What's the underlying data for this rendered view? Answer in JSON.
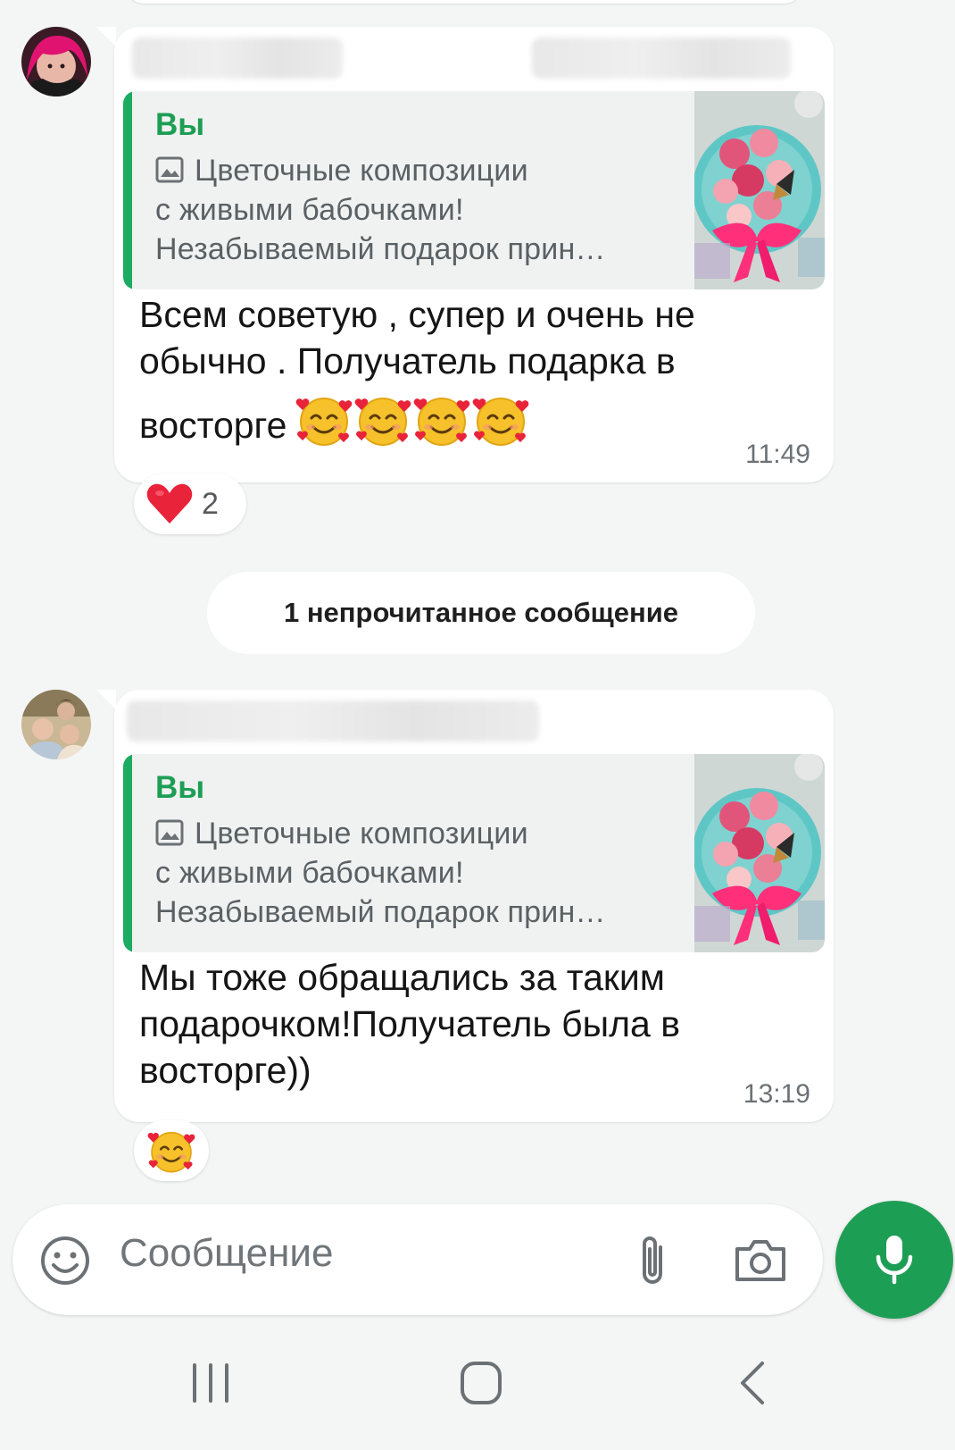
{
  "messages": [
    {
      "quote": {
        "author": "Вы",
        "lines": [
          "Цветочные композиции",
          "с живыми бабочками!",
          "Незабываемый подарок прин…"
        ]
      },
      "text": "Всем советую , супер и очень не обычно . Получатель подарка в восторге",
      "text_lines": [
        "Всем советую , супер и очень не",
        "обычно . Получатель подарка в",
        "восторге"
      ],
      "emoji": "smiling-face-with-hearts",
      "emoji_count": 4,
      "time": "11:49",
      "reaction": {
        "emoji": "red-heart",
        "count": "2"
      }
    },
    {
      "quote": {
        "author": "Вы",
        "lines": [
          "Цветочные композиции",
          "с живыми бабочками!",
          "Незабываемый подарок прин…"
        ]
      },
      "text_lines": [
        "Мы тоже обращались за таким",
        "подарочком!Получатель была в",
        "восторге))"
      ],
      "time": "13:19",
      "reaction": {
        "emoji": "smiling-face-with-hearts"
      }
    }
  ],
  "unread_divider": "1 непрочитанное сообщение",
  "composer": {
    "placeholder": "Сообщение"
  },
  "icons": {
    "emoji_button": "smiley-icon",
    "attach_button": "paperclip-icon",
    "camera_button": "camera-icon",
    "send_button": "microphone-icon",
    "nav": [
      "recent-apps-icon",
      "home-icon",
      "back-icon"
    ]
  },
  "colors": {
    "accent": "#1d9e55",
    "quote_bar": "#1daa61",
    "background": "#f4f5f5"
  }
}
